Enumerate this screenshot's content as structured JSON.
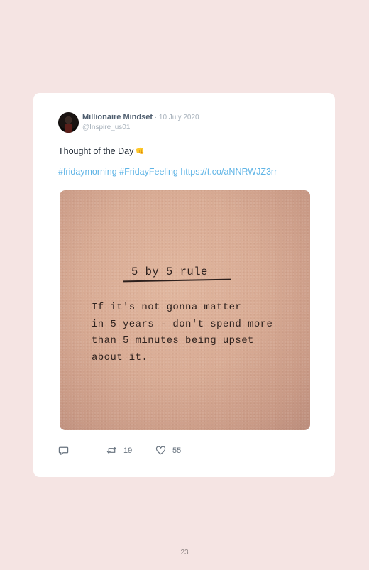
{
  "tweet": {
    "author_name": "Millionaire Mindset",
    "separator": " · ",
    "date": "10 July 2020",
    "handle": "@Inspire_us01",
    "text": "Thought of the Day",
    "emoji": "👊",
    "hashtag_1": "#fridaymorning",
    "hashtag_2": "#FridayFeeling",
    "link": "https://t.co/aNNRWJZ3rr",
    "image": {
      "title": "5 by 5 rule",
      "body": "If it's not gonna matter\nin 5 years - don't spend more\nthan 5 minutes being upset\nabout it."
    },
    "actions": {
      "reply_icon": "reply-icon",
      "retweet_icon": "retweet-icon",
      "retweet_count": "19",
      "like_icon": "heart-icon",
      "like_count": "55"
    }
  },
  "page_number": "23"
}
